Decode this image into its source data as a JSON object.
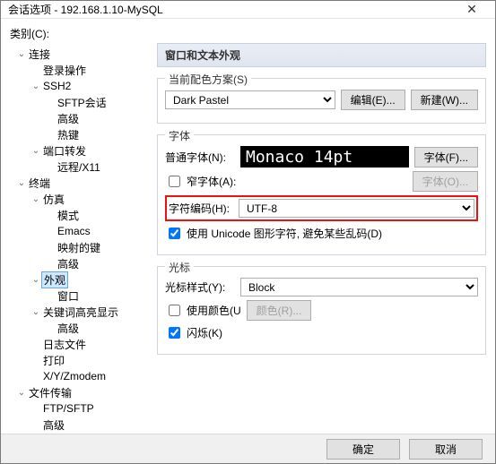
{
  "window": {
    "title": "会话选项 - 192.168.1.10-MySQL"
  },
  "category_label": "类别(C):",
  "tree": [
    {
      "label": "连接",
      "depth": 0,
      "exp": "open"
    },
    {
      "label": "登录操作",
      "depth": 1
    },
    {
      "label": "SSH2",
      "depth": 1,
      "exp": "open"
    },
    {
      "label": "SFTP会话",
      "depth": 2
    },
    {
      "label": "高级",
      "depth": 2
    },
    {
      "label": "热键",
      "depth": 2
    },
    {
      "label": "端口转发",
      "depth": 1,
      "exp": "open"
    },
    {
      "label": "远程/X11",
      "depth": 2
    },
    {
      "label": "终端",
      "depth": 0,
      "exp": "open"
    },
    {
      "label": "仿真",
      "depth": 1,
      "exp": "open"
    },
    {
      "label": "模式",
      "depth": 2
    },
    {
      "label": "Emacs",
      "depth": 2
    },
    {
      "label": "映射的键",
      "depth": 2
    },
    {
      "label": "高级",
      "depth": 2
    },
    {
      "label": "外观",
      "depth": 1,
      "exp": "open",
      "selected": true
    },
    {
      "label": "窗口",
      "depth": 2
    },
    {
      "label": "关键词高亮显示",
      "depth": 1,
      "exp": "open"
    },
    {
      "label": "高级",
      "depth": 2
    },
    {
      "label": "日志文件",
      "depth": 1
    },
    {
      "label": "打印",
      "depth": 1
    },
    {
      "label": "X/Y/Zmodem",
      "depth": 1
    },
    {
      "label": "文件传输",
      "depth": 0,
      "exp": "open"
    },
    {
      "label": "FTP/SFTP",
      "depth": 1
    },
    {
      "label": "高级",
      "depth": 1
    }
  ],
  "panel": {
    "heading": "窗口和文本外观",
    "scheme": {
      "group_title": "当前配色方案(S)",
      "value": "Dark Pastel",
      "edit_btn": "编辑(E)...",
      "new_btn": "新建(W)..."
    },
    "fonts": {
      "group_title": "字体",
      "normal_label": "普通字体(N):",
      "preview": "Monaco 14pt",
      "font_btn": "字体(F)...",
      "narrow_cb": "窄字体(A):",
      "font_btn2": "字体(O)...",
      "encoding_label": "字符编码(H):",
      "encoding_value": "UTF-8",
      "unicode_cb": "使用 Unicode 图形字符, 避免某些乱码(D)"
    },
    "cursor": {
      "group_title": "光标",
      "style_label": "光标样式(Y):",
      "style_value": "Block",
      "color_cb": "使用颜色(U",
      "color_btn": "颜色(R)...",
      "blink_cb": "闪烁(K)"
    }
  },
  "footer": {
    "ok": "确定",
    "cancel": "取消"
  }
}
